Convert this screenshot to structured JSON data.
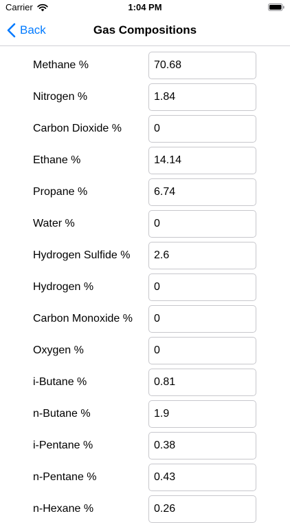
{
  "status_bar": {
    "carrier": "Carrier",
    "time": "1:04 PM"
  },
  "nav": {
    "back_label": "Back",
    "title": "Gas Compositions",
    "accent_color": "#007aff"
  },
  "fields": [
    {
      "label": "Methane %",
      "value": "70.68"
    },
    {
      "label": "Nitrogen %",
      "value": "1.84"
    },
    {
      "label": "Carbon Dioxide %",
      "value": "0"
    },
    {
      "label": "Ethane %",
      "value": "14.14"
    },
    {
      "label": "Propane %",
      "value": "6.74"
    },
    {
      "label": "Water %",
      "value": "0"
    },
    {
      "label": "Hydrogen Sulfide %",
      "value": "2.6"
    },
    {
      "label": "Hydrogen %",
      "value": "0"
    },
    {
      "label": "Carbon Monoxide %",
      "value": "0"
    },
    {
      "label": "Oxygen %",
      "value": "0"
    },
    {
      "label": "i-Butane %",
      "value": "0.81"
    },
    {
      "label": "n-Butane %",
      "value": "1.9"
    },
    {
      "label": "i-Pentane %",
      "value": "0.38"
    },
    {
      "label": "n-Pentane %",
      "value": "0.43"
    },
    {
      "label": "n-Hexane %",
      "value": "0.26"
    }
  ]
}
